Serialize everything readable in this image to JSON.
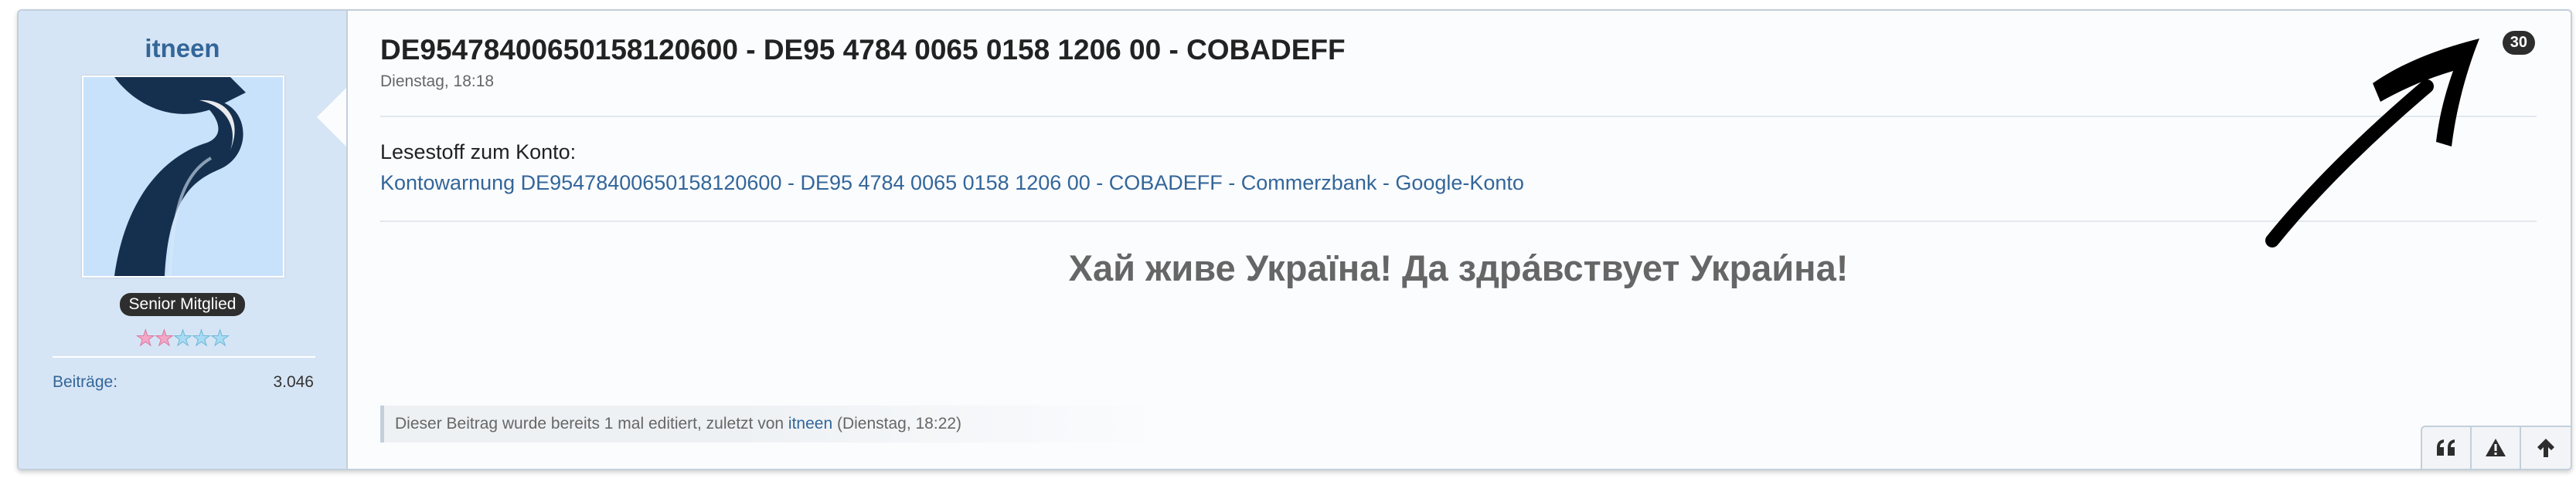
{
  "post": {
    "author": {
      "username": "itneen",
      "rank": "Senior Mitglied",
      "rating_stars": 5,
      "rating_filled": 2,
      "stats": [
        {
          "label": "Beiträge:",
          "value": "3.046"
        }
      ],
      "avatar_glyph": "٢"
    },
    "title": "DE95478400650158120600 - DE95 4784 0065 0158 1206 00 - COBADEFF",
    "date": "Dienstag, 18:18",
    "counter": "30",
    "body": {
      "reading_label": "Lesestoff zum Konto:",
      "reading_link": "Kontowarnung DE95478400650158120600 - DE95 4784 0065 0158 1206 00 - COBADEFF - Commerzbank - Google-Konto",
      "headline": "Хай живе Україна! Да здра́вствует Украи́на!"
    },
    "edit_note": {
      "prefix": "Dieser Beitrag wurde bereits 1 mal editiert, zuletzt von ",
      "user": "itneen",
      "suffix": " (Dienstag, 18:22)"
    },
    "actions": [
      {
        "name": "quote-button",
        "icon": "quote-icon"
      },
      {
        "name": "report-button",
        "icon": "warning-icon"
      },
      {
        "name": "scroll-top-button",
        "icon": "arrow-up-icon"
      }
    ]
  },
  "colors": {
    "sidebar_bg": "#d6e5f5",
    "link": "#336699",
    "badge_bg": "#2d2d2d",
    "post_bg": "#fbfcfe",
    "border": "#c3cfdb"
  }
}
